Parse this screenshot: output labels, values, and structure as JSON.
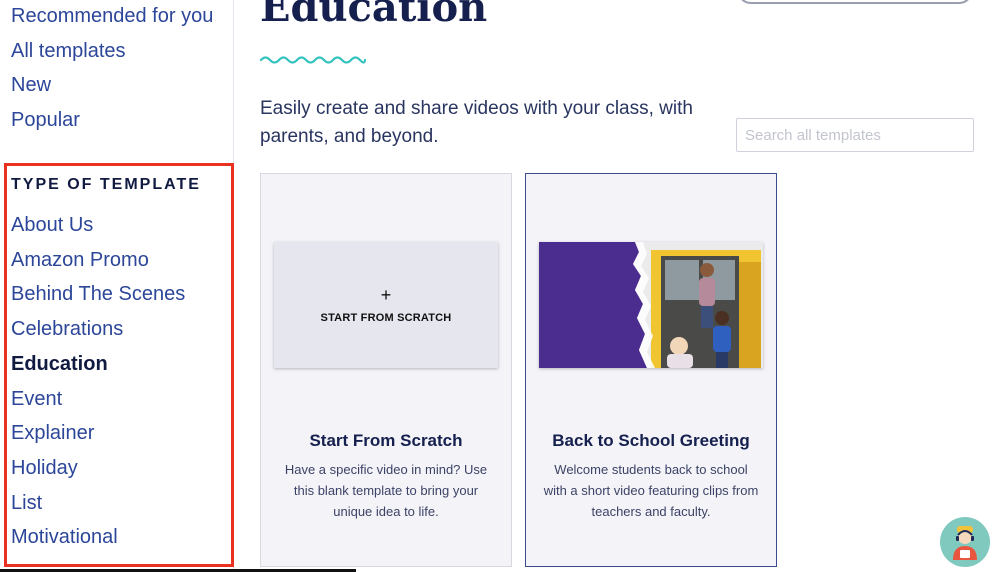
{
  "sidebar": {
    "top_links": [
      "Recommended for you",
      "All templates",
      "New",
      "Popular"
    ],
    "section_title": "TYPE OF TEMPLATE",
    "types": [
      "About Us",
      "Amazon Promo",
      "Behind The Scenes",
      "Celebrations",
      "Education",
      "Event",
      "Explainer",
      "Holiday",
      "List",
      "Motivational"
    ],
    "active_type": "Education"
  },
  "main": {
    "title": "Education",
    "intro": "Easily create and share videos with your class, with parents, and beyond.",
    "search_placeholder": "Search all templates"
  },
  "cards": [
    {
      "thumb_label": "START FROM SCRATCH",
      "title": "Start From Scratch",
      "description": "Have a specific video in mind? Use this blank template to bring your unique idea to life."
    },
    {
      "title": "Back to School Greeting",
      "description": "Welcome students back to school with a short video featuring clips from teachers and faculty."
    }
  ],
  "colors": {
    "accent_teal": "#35c3c0",
    "highlight_red": "#e8321f",
    "link_blue": "#2c4699",
    "navy": "#16204f",
    "thumb_purple": "#4b2d8f",
    "bus_yellow": "#f0c531"
  },
  "icons": {
    "plus": "+",
    "help": "support-avatar-icon"
  }
}
